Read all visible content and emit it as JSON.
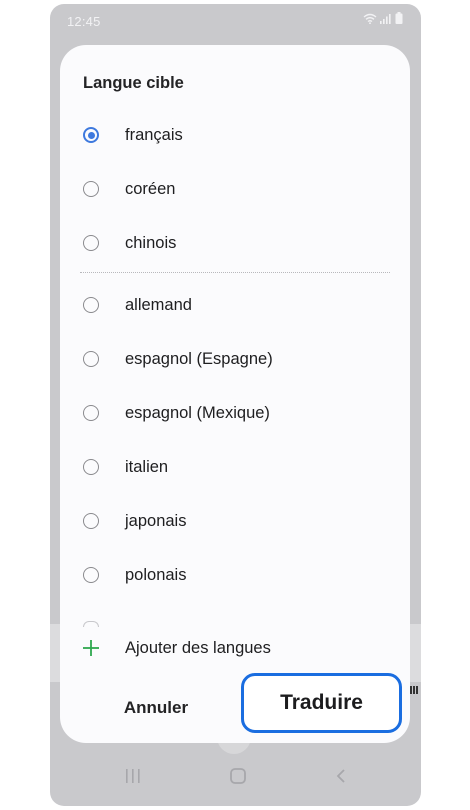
{
  "status_bar": {
    "time": "12:45",
    "icons": [
      "wifi-icon",
      "signal-icon",
      "battery-icon"
    ]
  },
  "dialog": {
    "title": "Langue cible",
    "options": [
      {
        "label": "français",
        "selected": true
      },
      {
        "label": "coréen",
        "selected": false
      },
      {
        "label": "chinois",
        "selected": false
      },
      {
        "label": "allemand",
        "selected": false
      },
      {
        "label": "espagnol (Espagne)",
        "selected": false
      },
      {
        "label": "espagnol (Mexique)",
        "selected": false
      },
      {
        "label": "italien",
        "selected": false
      },
      {
        "label": "japonais",
        "selected": false
      },
      {
        "label": "polonais",
        "selected": false
      }
    ],
    "add_languages_label": "Ajouter des langues",
    "cancel_label": "Annuler",
    "translate_label": "Traduire"
  },
  "nav_bar": {
    "icons": [
      "recent-apps-icon",
      "home-icon",
      "back-icon"
    ]
  },
  "colors": {
    "accent": "#3e79de",
    "highlight_border": "#1a6de0",
    "add_icon": "#2fa84f"
  }
}
